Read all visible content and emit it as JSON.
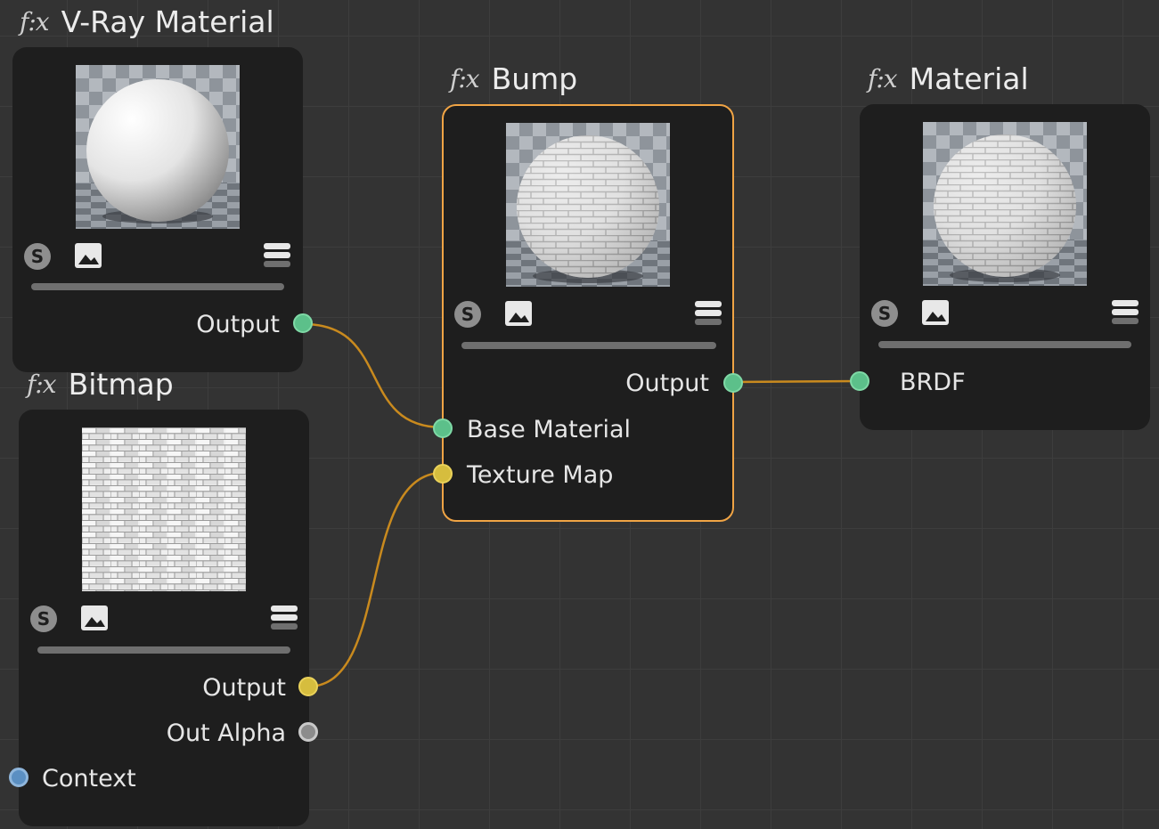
{
  "colors": {
    "canvas": "#333333",
    "node_bg": "#1e1e1e",
    "selected_border": "#f0a445",
    "wire": "#c98a1e",
    "port_green": "#5cc08a",
    "port_yellow": "#d6bd3e",
    "port_grey": "#8c8c8c",
    "port_blue": "#5b8fc2"
  },
  "nodes": {
    "vray_material": {
      "prefix": "f:x",
      "title": "V-Ray Material",
      "icons": [
        "s-icon",
        "image-icon",
        "menu-icon"
      ],
      "outputs": [
        "Output"
      ]
    },
    "bitmap": {
      "prefix": "f:x",
      "title": "Bitmap",
      "icons": [
        "s-icon",
        "image-icon",
        "menu-icon"
      ],
      "outputs": [
        "Output",
        "Out Alpha"
      ],
      "inputs": [
        "Context"
      ]
    },
    "bump": {
      "prefix": "f:x",
      "title": "Bump",
      "selected": true,
      "icons": [
        "s-icon",
        "image-icon",
        "menu-icon"
      ],
      "outputs": [
        "Output"
      ],
      "inputs": [
        "Base Material",
        "Texture Map"
      ]
    },
    "material": {
      "prefix": "f:x",
      "title": "Material",
      "icons": [
        "s-icon",
        "image-icon",
        "menu-icon"
      ],
      "inputs": [
        "BRDF"
      ]
    }
  },
  "connections": [
    {
      "from": "V-Ray Material.Output",
      "to": "Bump.Base Material"
    },
    {
      "from": "Bitmap.Output",
      "to": "Bump.Texture Map"
    },
    {
      "from": "Bump.Output",
      "to": "Material.BRDF"
    }
  ]
}
